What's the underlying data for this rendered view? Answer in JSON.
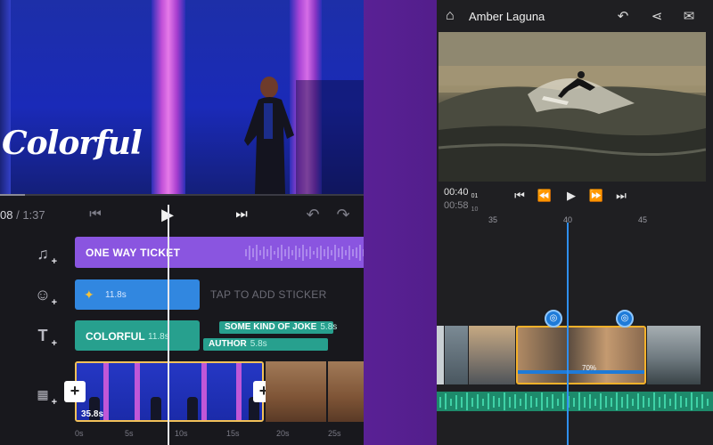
{
  "left_app": {
    "hero_title": "Colorful",
    "time_current": "08",
    "time_total": "/ 1:37",
    "tracks": {
      "audio_label": "ONE WAY TICKET",
      "sticker_duration": "11.8s",
      "sticker_hint": "TAP TO ADD STICKER",
      "text_label": "COLORFUL",
      "text_duration": "11.8s",
      "text_items": [
        {
          "label": "SOME KIND OF JOKE",
          "duration": "5.8s"
        },
        {
          "label": "AUTHOR",
          "duration": "5.8s"
        }
      ],
      "video_duration": "35.8s"
    },
    "ruler": [
      "0s",
      "5s",
      "10s",
      "15s",
      "20s",
      "25s"
    ],
    "colors": {
      "audio": "#8a55e0",
      "sticker": "#3187e0",
      "text": "#27a08e",
      "selection": "#f2c15a"
    }
  },
  "right_app": {
    "project_title": "Amber Laguna",
    "timecode_current": "00:40",
    "timecode_current_frames": "01",
    "timecode_total": "00:58",
    "timecode_total_frames": "10",
    "ruler": [
      "35",
      "40",
      "45"
    ],
    "clip_speed": "70%",
    "colors": {
      "selection": "#f5b12a",
      "playhead": "#2f8ff0",
      "audio": "#1d8a6b"
    }
  }
}
